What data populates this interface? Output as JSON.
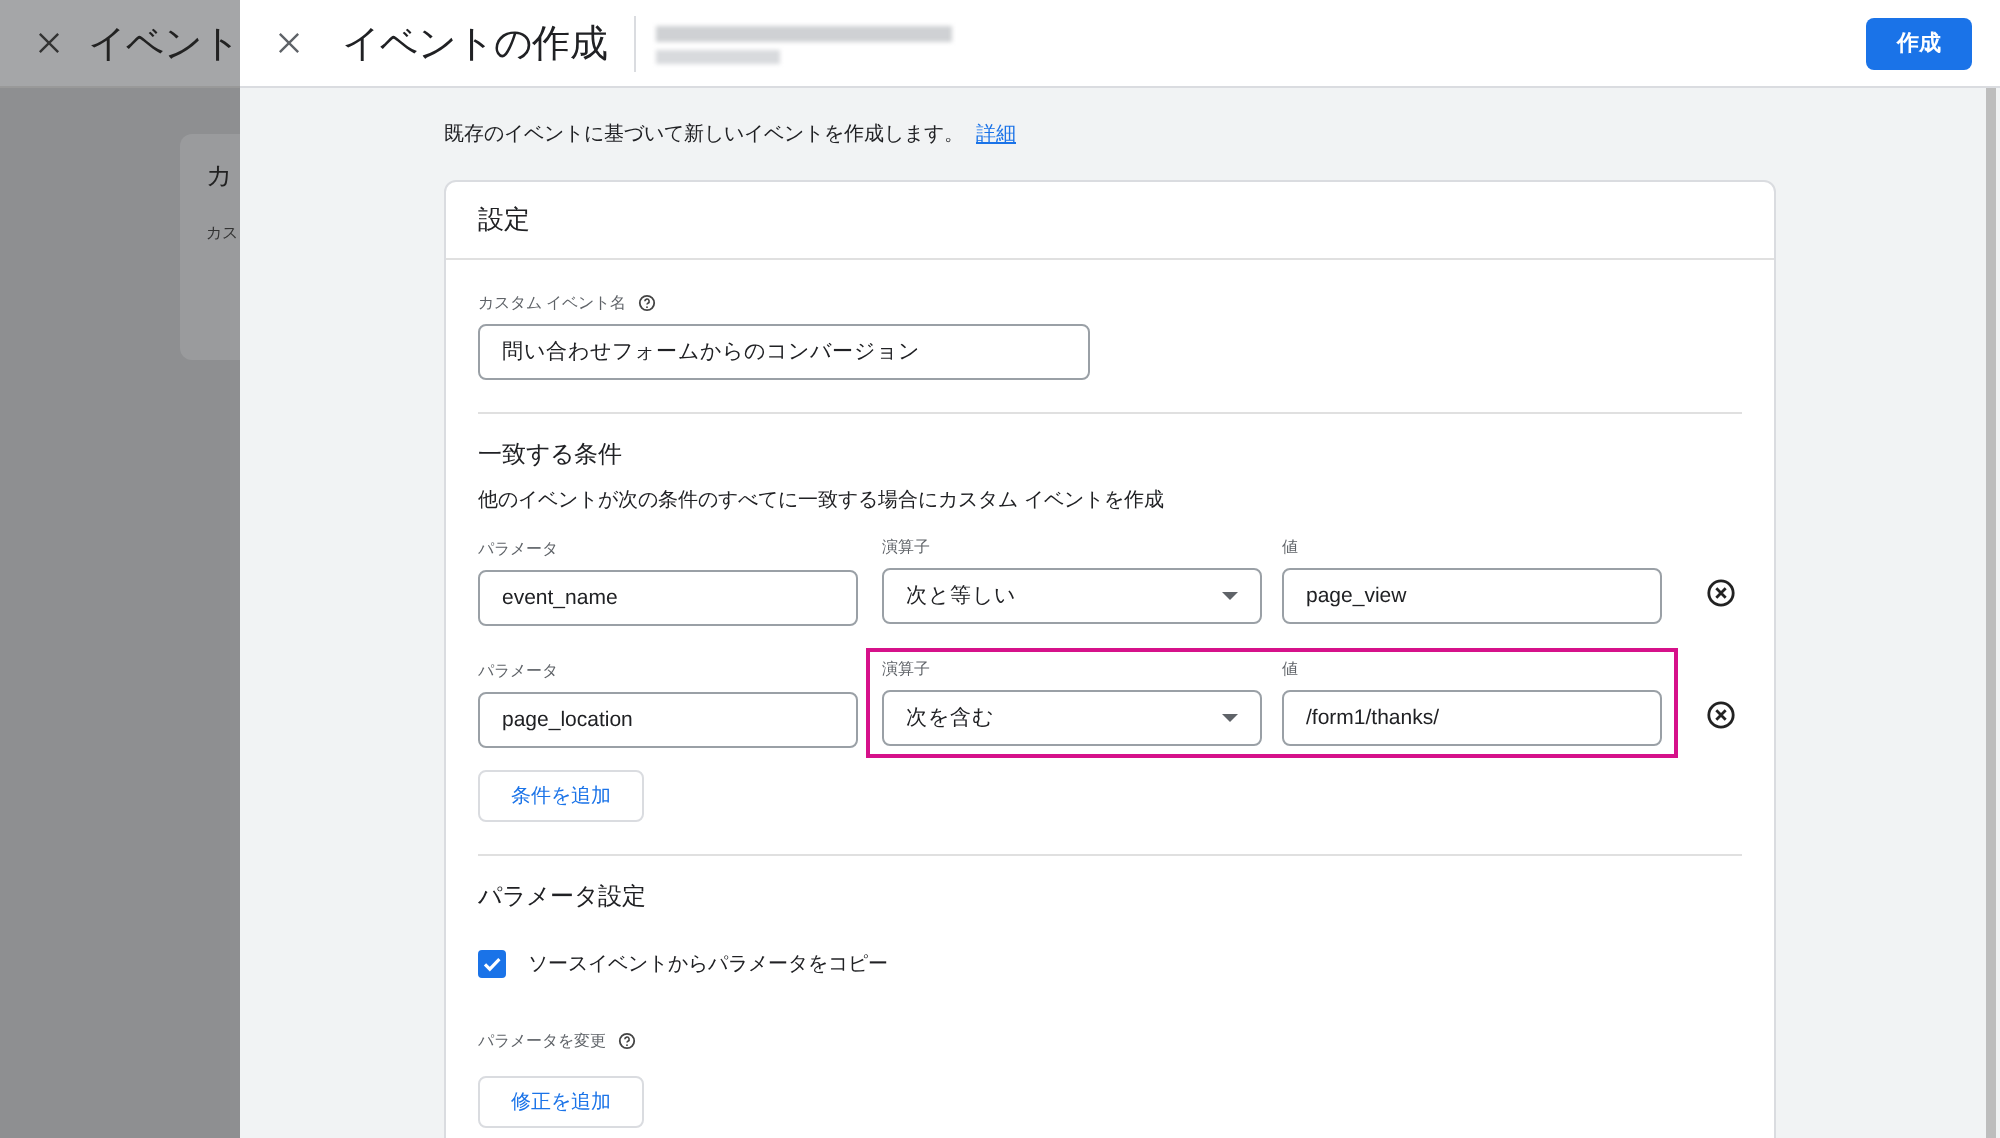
{
  "background_page": {
    "title": "イベント",
    "card_title": "カ",
    "card_label": "カス"
  },
  "panel": {
    "title": "イベントの作成",
    "create_button": "作成"
  },
  "intro": {
    "text": "既存のイベントに基づいて新しいイベントを作成します。",
    "link": "詳細"
  },
  "settings_card": {
    "title": "設定",
    "event_name": {
      "label": "カスタム イベント名",
      "value": "問い合わせフォームからのコンバージョン"
    },
    "conditions": {
      "title": "一致する条件",
      "description": "他のイベントが次の条件のすべてに一致する場合にカスタム イベントを作成",
      "rows": [
        {
          "parameter_label": "パラメータ",
          "parameter": "event_name",
          "operator_label": "演算子",
          "operator": "次と等しい",
          "value_label": "値",
          "value": "page_view",
          "highlighted": false
        },
        {
          "parameter_label": "パラメータ",
          "parameter": "page_location",
          "operator_label": "演算子",
          "operator": "次を含む",
          "value_label": "値",
          "value": "/form1/thanks/",
          "highlighted": true
        }
      ],
      "add_button": "条件を追加"
    },
    "parameter_settings": {
      "title": "パラメータ設定",
      "copy_checkbox": {
        "label": "ソースイベントからパラメータをコピー",
        "checked": true
      },
      "modify_label": "パラメータを変更",
      "add_button": "修正を追加"
    }
  }
}
